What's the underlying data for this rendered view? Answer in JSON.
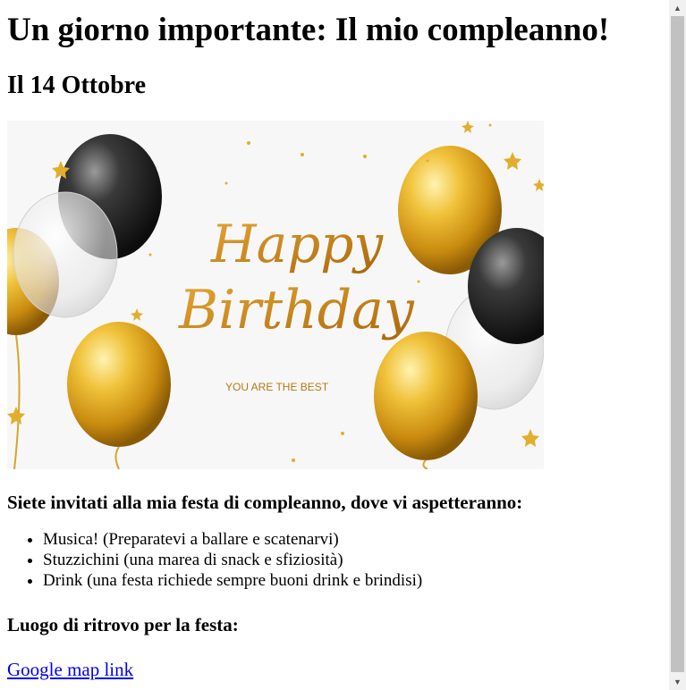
{
  "page": {
    "title": "Un giorno importante: Il mio compleanno!",
    "date": "Il 14 Ottobre",
    "banner": {
      "script_line1": "Happy",
      "script_line2": "Birthday",
      "tagline": "YOU ARE THE BEST"
    },
    "invite_heading": "Siete invitati alla mia festa di compleanno, dove vi aspetteranno:",
    "items": [
      "Musica! (Preparatevi a ballare e scatenarvi)",
      "Stuzzichini (una marea di snack e sfiziosità)",
      "Drink (una festa richiede sempre buoni drink e brindisi)"
    ],
    "place_heading": "Luogo di ritrovo per la festa:",
    "map_link": "Google map link"
  },
  "colors": {
    "gold": "#d9a21f",
    "black_balloon": "#2b2b2b",
    "link": "#0000ee"
  }
}
